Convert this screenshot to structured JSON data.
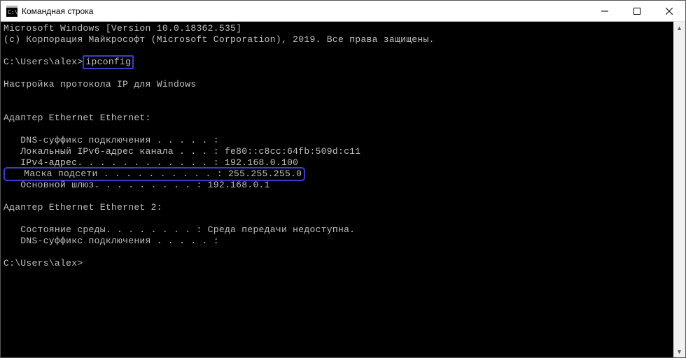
{
  "window": {
    "title": "Командная строка"
  },
  "terminal": {
    "line_version": "Microsoft Windows [Version 10.0.18362.535]",
    "line_copyright": "(c) Корпорация Майкрософт (Microsoft Corporation), 2019. Все права защищены.",
    "prompt1_prefix": "C:\\Users\\alex>",
    "prompt1_cmd": "ipconfig",
    "heading": "Настройка протокола IP для Windows",
    "adapter1_title": "Адаптер Ethernet Ethernet:",
    "a1_dns": "   DNS-суффикс подключения . . . . . :",
    "a1_ipv6": "   Локальный IPv6-адрес канала . . . : fe80::c8cc:64fb:509d:c11",
    "a1_ipv4": "   IPv4-адрес. . . . . . . . . . . . : 192.168.0.100",
    "a1_mask": "   Маска подсети . . . . . . . . . . : 255.255.255.0",
    "a1_gw": "   Основной шлюз. . . . . . . . . : 192.168.0.1",
    "adapter2_title": "Адаптер Ethernet Ethernet 2:",
    "a2_state": "   Состояние среды. . . . . . . . : Среда передачи недоступна.",
    "a2_dns": "   DNS-суффикс подключения . . . . . :",
    "prompt2": "C:\\Users\\alex>"
  }
}
